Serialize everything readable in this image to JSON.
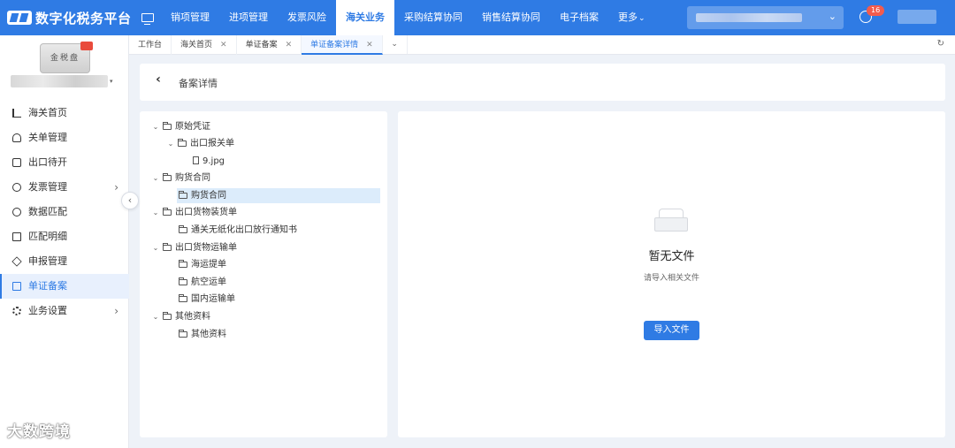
{
  "app": {
    "logo_text": "数字化税务平台"
  },
  "topnav": {
    "items": [
      "销项管理",
      "进项管理",
      "发票风险",
      "海关业务",
      "采购结算协同",
      "销售结算协同",
      "电子档案"
    ],
    "active": "海关业务",
    "more_label": "更多",
    "notification_count": "16"
  },
  "sidebar": {
    "card_label": "金税盘",
    "items": [
      {
        "label": "海关首页",
        "icon": "bar-chart-icon"
      },
      {
        "label": "关单管理",
        "icon": "person-icon"
      },
      {
        "label": "出口待开",
        "icon": "box-icon"
      },
      {
        "label": "发票管理",
        "icon": "invoice-icon",
        "has_children": true
      },
      {
        "label": "数据匹配",
        "icon": "match-icon"
      },
      {
        "label": "匹配明细",
        "icon": "detail-icon"
      },
      {
        "label": "申报管理",
        "icon": "layers-icon"
      },
      {
        "label": "单证备案",
        "icon": "doc-icon",
        "active": true
      },
      {
        "label": "业务设置",
        "icon": "settings-icon",
        "has_children": true
      }
    ],
    "watermark": "大数跨境"
  },
  "tabs": [
    {
      "label": "工作台",
      "closable": false
    },
    {
      "label": "海关首页",
      "closable": true
    },
    {
      "label": "单证备案",
      "closable": true
    },
    {
      "label": "单证备案详情",
      "closable": true,
      "active": true
    }
  ],
  "header": {
    "title": "备案详情"
  },
  "tree": [
    {
      "label": "原始凭证",
      "type": "folder",
      "level": 0,
      "expanded": true
    },
    {
      "label": "出口报关单",
      "type": "folder",
      "level": 1,
      "expanded": true
    },
    {
      "label": "9.jpg",
      "type": "file",
      "level": 2
    },
    {
      "label": "购货合同",
      "type": "folder",
      "level": 0,
      "expanded": true
    },
    {
      "label": "购货合同",
      "type": "folder",
      "level": 1,
      "selected": true
    },
    {
      "label": "出口货物装货单",
      "type": "folder",
      "level": 0,
      "expanded": true
    },
    {
      "label": "通关无纸化出口放行通知书",
      "type": "folder",
      "level": 1
    },
    {
      "label": "出口货物运输单",
      "type": "folder",
      "level": 0,
      "expanded": true
    },
    {
      "label": "海运提单",
      "type": "folder",
      "level": 1
    },
    {
      "label": "航空运单",
      "type": "folder",
      "level": 1
    },
    {
      "label": "国内运输单",
      "type": "folder",
      "level": 1
    },
    {
      "label": "其他资料",
      "type": "folder",
      "level": 0,
      "expanded": true
    },
    {
      "label": "其他资料",
      "type": "folder",
      "level": 1
    }
  ],
  "empty_state": {
    "title": "暂无文件",
    "subtitle": "请导入相关文件",
    "button_label": "导入文件"
  },
  "colors": {
    "primary": "#2f7be4",
    "badge": "#f35b4d"
  }
}
